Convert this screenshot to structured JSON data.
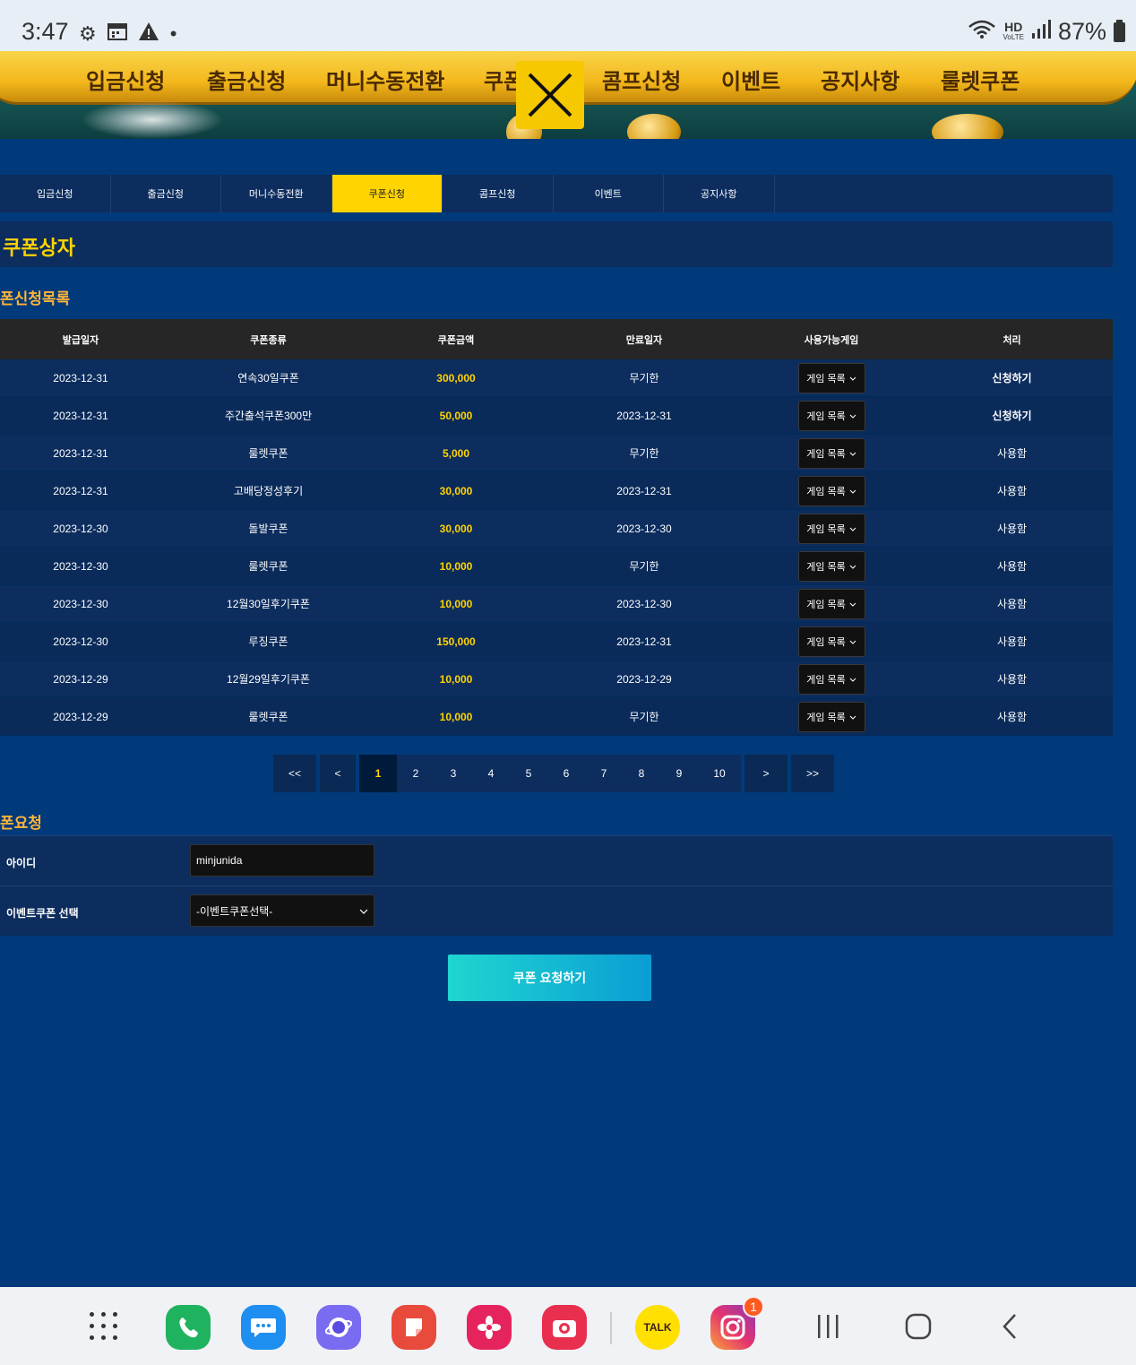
{
  "status_bar": {
    "time": "3:47",
    "battery": "87%",
    "hd": "HD",
    "hd_sub": "VoLTE"
  },
  "banner_menu": [
    "입금신청",
    "출금신청",
    "머니수동전환",
    "쿠폰",
    "콤프신청",
    "이벤트",
    "공지사항",
    "룰렛쿠폰"
  ],
  "sub_nav": [
    "입금신청",
    "출금신청",
    "머니수동전환",
    "쿠폰신청",
    "콤프신청",
    "이벤트",
    "공지사항"
  ],
  "active_tab_index": 3,
  "page_title": "쿠폰상자",
  "list_section_title": "폰신청목록",
  "table": {
    "headers": [
      "발급일자",
      "쿠폰종류",
      "쿠폰금액",
      "만료일자",
      "사용가능게임",
      "처리"
    ],
    "rows": [
      {
        "date": "2023-12-31",
        "type": "연속30일쿠폰",
        "amount": "300,000",
        "expire": "무기한",
        "game": "게임 목록",
        "action": "신청하기",
        "applicable": true
      },
      {
        "date": "2023-12-31",
        "type": "주간출석쿠폰300만",
        "amount": "50,000",
        "expire": "2023-12-31",
        "game": "게임 목록",
        "action": "신청하기",
        "applicable": true
      },
      {
        "date": "2023-12-31",
        "type": "룰렛쿠폰",
        "amount": "5,000",
        "expire": "무기한",
        "game": "게임 목록",
        "action": "사용함",
        "applicable": false
      },
      {
        "date": "2023-12-31",
        "type": "고배당정성후기",
        "amount": "30,000",
        "expire": "2023-12-31",
        "game": "게임 목록",
        "action": "사용함",
        "applicable": false
      },
      {
        "date": "2023-12-30",
        "type": "돌발쿠폰",
        "amount": "30,000",
        "expire": "2023-12-30",
        "game": "게임 목록",
        "action": "사용함",
        "applicable": false
      },
      {
        "date": "2023-12-30",
        "type": "룰렛쿠폰",
        "amount": "10,000",
        "expire": "무기한",
        "game": "게임 목록",
        "action": "사용함",
        "applicable": false
      },
      {
        "date": "2023-12-30",
        "type": "12월30일후기쿠폰",
        "amount": "10,000",
        "expire": "2023-12-30",
        "game": "게임 목록",
        "action": "사용함",
        "applicable": false
      },
      {
        "date": "2023-12-30",
        "type": "루징쿠폰",
        "amount": "150,000",
        "expire": "2023-12-31",
        "game": "게임 목록",
        "action": "사용함",
        "applicable": false
      },
      {
        "date": "2023-12-29",
        "type": "12월29일후기쿠폰",
        "amount": "10,000",
        "expire": "2023-12-29",
        "game": "게임 목록",
        "action": "사용함",
        "applicable": false
      },
      {
        "date": "2023-12-29",
        "type": "룰렛쿠폰",
        "amount": "10,000",
        "expire": "무기한",
        "game": "게임 목록",
        "action": "사용함",
        "applicable": false
      }
    ]
  },
  "pagination": {
    "first": "<<",
    "prev": "<",
    "pages": [
      "1",
      "2",
      "3",
      "4",
      "5",
      "6",
      "7",
      "8",
      "9",
      "10"
    ],
    "current": "1",
    "next": ">",
    "last": ">>"
  },
  "request_section_title": "폰요청",
  "form": {
    "id_label": "아이디",
    "id_value": "minjunida",
    "coupon_label": "이벤트쿠폰 선택",
    "coupon_selected": "-이벤트쿠폰선택-"
  },
  "submit_label": "쿠폰 요청하기",
  "dock": {
    "apps": [
      {
        "name": "phone-app",
        "color": "#1fb35f"
      },
      {
        "name": "messages-app",
        "color": "#1e8ff0"
      },
      {
        "name": "internet-app",
        "color": "#7a6cf0"
      },
      {
        "name": "notes-app",
        "color": "#e84a3b"
      },
      {
        "name": "gallery-app",
        "color": "#e5245e"
      },
      {
        "name": "camera-app",
        "color": "#e8304e"
      },
      {
        "name": "kakaotalk-app",
        "color": "#ffe000"
      },
      {
        "name": "instagram-app",
        "color": "#d62f7c"
      }
    ],
    "kakao_label": "TALK",
    "instagram_badge": "1"
  }
}
